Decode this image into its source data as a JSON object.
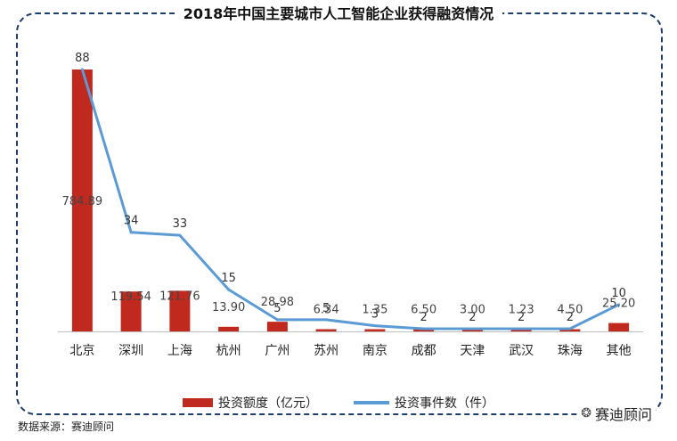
{
  "title": "2018年中国主要城市人工智能企业获得融资情况",
  "source": "数据来源：赛迪顾问",
  "brand": "赛迪顾问",
  "colors": {
    "bar": "#c0291e",
    "line": "#5b9bd5",
    "frame": "#1f3e70"
  },
  "chart_data": {
    "type": "bar",
    "categories": [
      "北京",
      "深圳",
      "上海",
      "杭州",
      "广州",
      "苏州",
      "南京",
      "成都",
      "天津",
      "武汉",
      "珠海",
      "其他"
    ],
    "series": [
      {
        "name": "投资额度（亿元）",
        "type": "bar",
        "values": [
          784.89,
          119.54,
          121.76,
          13.9,
          28.98,
          6.34,
          1.35,
          6.5,
          3.0,
          1.23,
          4.5,
          25.2
        ],
        "labels": [
          "784.89",
          "119.54",
          "121.76",
          "13.90",
          "28.98",
          "6.34",
          "1.35",
          "6.50",
          "3.00",
          "1.23",
          "4.50",
          "25.20"
        ]
      },
      {
        "name": "投资事件数（件）",
        "type": "line",
        "values": [
          88,
          34,
          33,
          15,
          5,
          5,
          3,
          2,
          2,
          2,
          2,
          10
        ],
        "labels": [
          "88",
          "34",
          "33",
          "15",
          "5",
          "5",
          "3",
          "2",
          "2",
          "2",
          "2",
          "10"
        ]
      }
    ],
    "legend_position": "bottom",
    "grid": false
  }
}
